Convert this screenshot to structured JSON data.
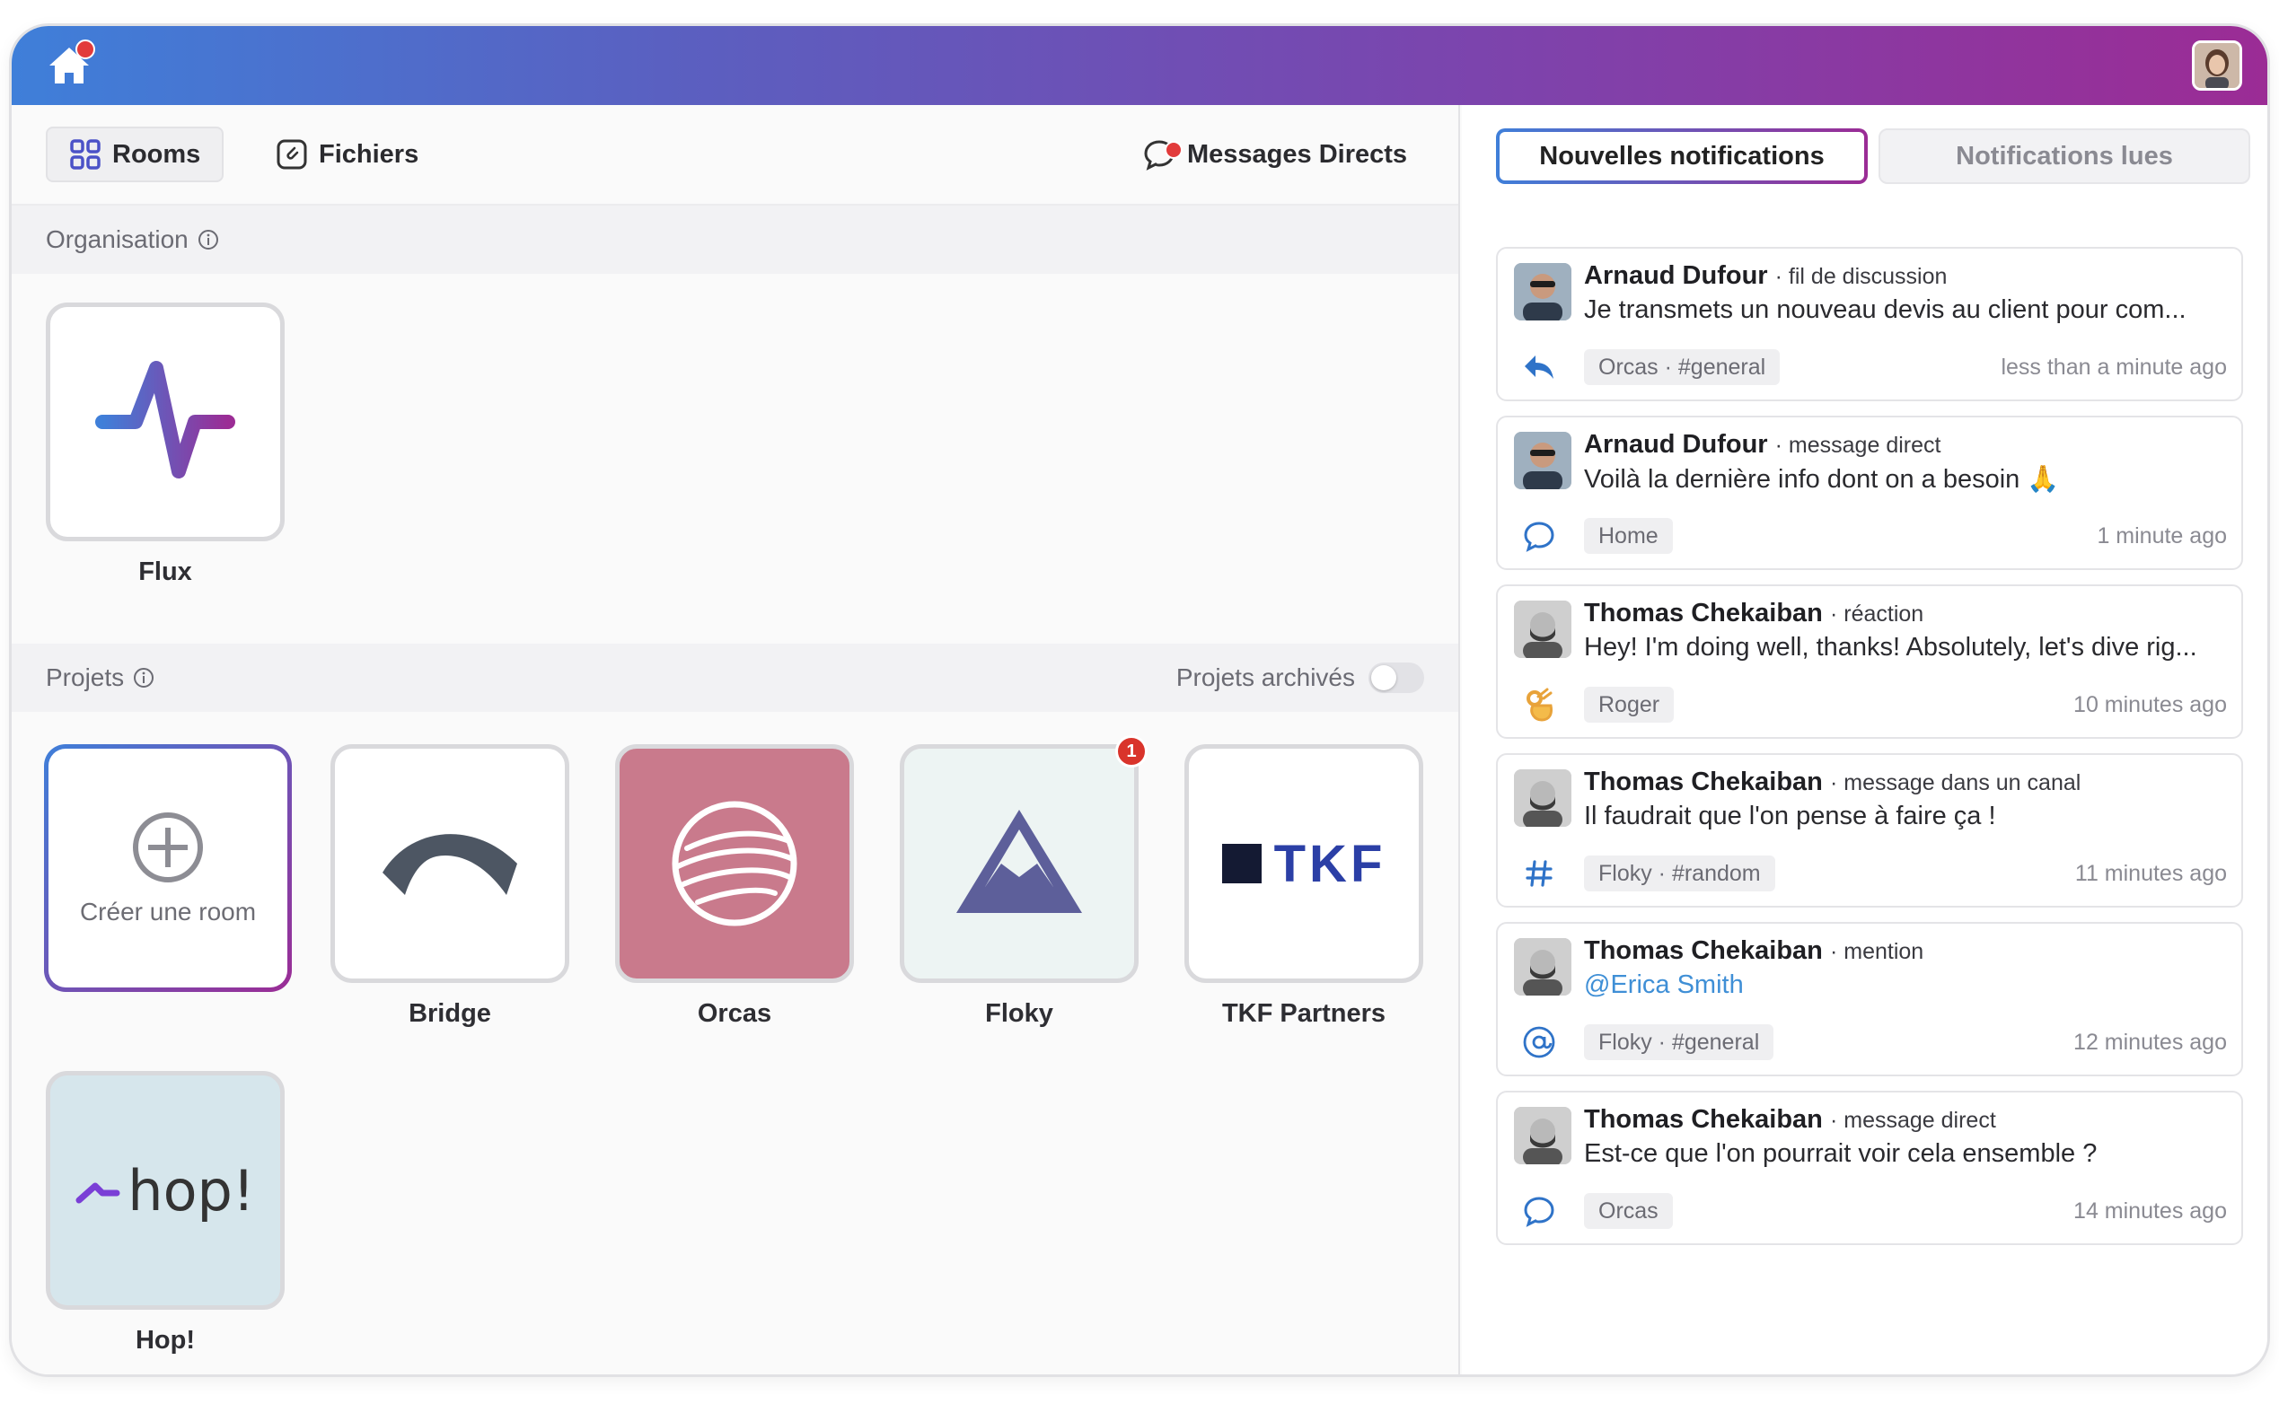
{
  "nav": {
    "rooms": "Rooms",
    "files": "Fichiers",
    "direct_messages": "Messages Directs"
  },
  "organisation": {
    "title": "Organisation",
    "tiles": [
      {
        "label": "Flux"
      }
    ]
  },
  "projects": {
    "title": "Projets",
    "archived_label": "Projets archivés",
    "create_label": "Créer une room",
    "tiles": [
      {
        "label": "Bridge"
      },
      {
        "label": "Orcas"
      },
      {
        "label": "Floky",
        "badge": "1"
      },
      {
        "label": "TKF Partners",
        "logo_text": "TKF"
      },
      {
        "label": "Hop!",
        "logo_text": "hop!"
      }
    ]
  },
  "notifications": {
    "tab_new": "Nouvelles notifications",
    "tab_read": "Notifications lues",
    "items": [
      {
        "name": "Arnaud Dufour",
        "type": "· fil de discussion",
        "text": "Je transmets un nouveau devis au client pour com...",
        "chip": "Orcas · #general",
        "time": "less than a minute ago",
        "icon": "reply-icon"
      },
      {
        "name": "Arnaud Dufour",
        "type": "· message direct",
        "text": "Voilà la dernière info dont on a besoin 🙏",
        "chip": "Home",
        "time": "1 minute ago",
        "icon": "chat-bubble-icon"
      },
      {
        "name": "Thomas Chekaiban",
        "type": "· réaction",
        "text": "Hey! I'm doing well, thanks! Absolutely, let's dive rig...",
        "chip": "Roger",
        "time": "10 minutes ago",
        "icon": "ok-hand-icon"
      },
      {
        "name": "Thomas Chekaiban",
        "type": "· message dans un canal",
        "text": "Il faudrait que l'on pense à faire ça !",
        "chip": "Floky · #random",
        "time": "11 minutes ago",
        "icon": "hash-icon"
      },
      {
        "name": "Thomas Chekaiban",
        "type": "· mention",
        "text": "@Erica Smith",
        "chip": "Floky · #general",
        "time": "12 minutes ago",
        "icon": "at-icon"
      },
      {
        "name": "Thomas Chekaiban",
        "type": "· message direct",
        "text": "Est-ce que l'on pourrait voir cela ensemble ?",
        "chip": "Orcas",
        "time": "14 minutes ago",
        "icon": "chat-bubble-icon"
      }
    ]
  },
  "colors": {
    "gradient_start": "#3f7fd9",
    "gradient_end": "#9b2c95",
    "orcas_bg": "#c97a8c",
    "floky_bg": "#edf4f3",
    "hop_bg": "#d6e6ec",
    "tkf_text": "#2b3fa6"
  }
}
